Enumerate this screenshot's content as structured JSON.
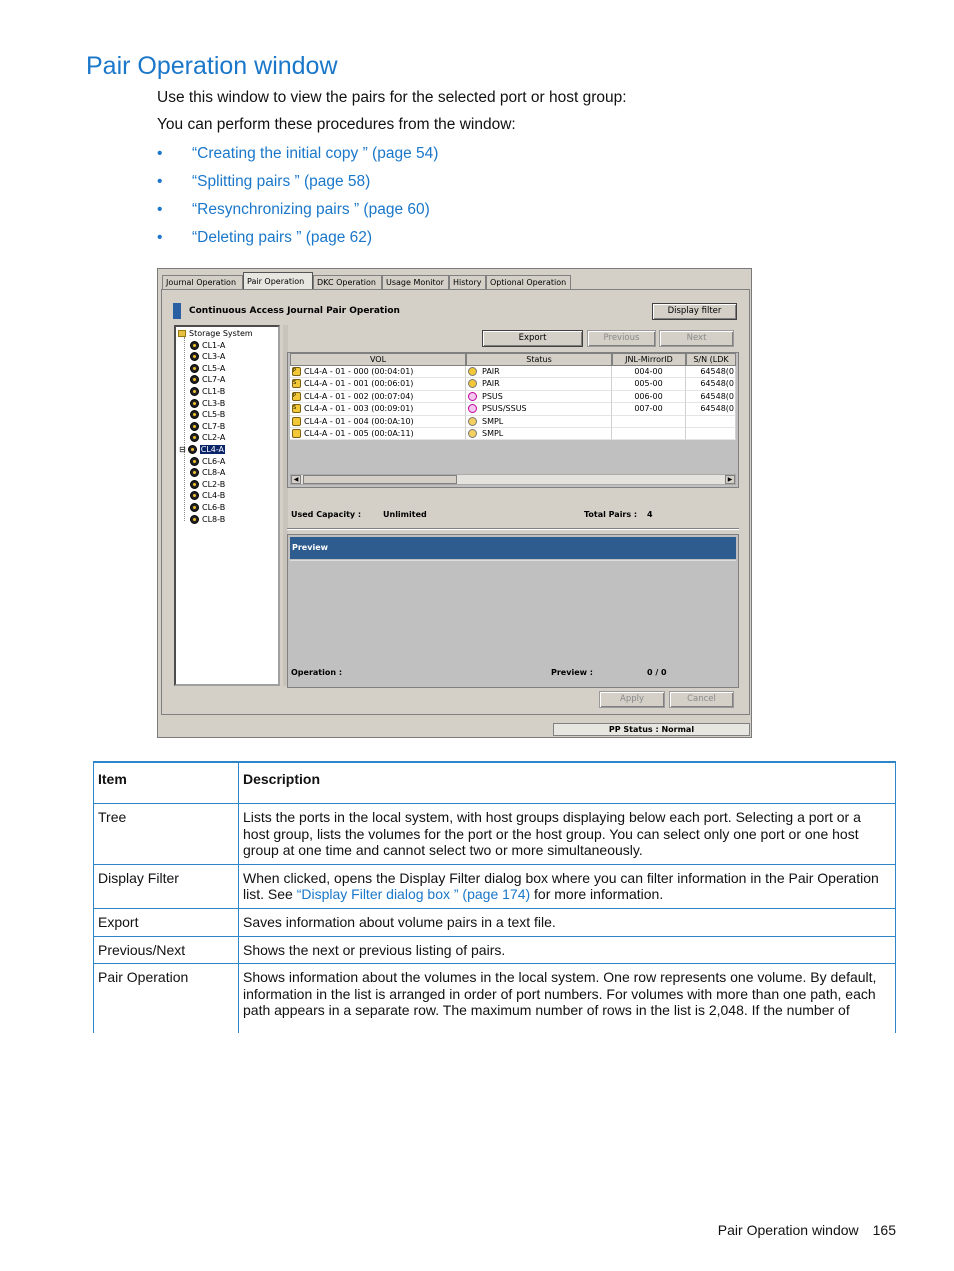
{
  "page_title": "Pair Operation window",
  "intro": "Use this window to view the pairs for the selected port or host group:",
  "procedures_intro": "You can perform these procedures from the window:",
  "procedures": [
    {
      "bullet": "•",
      "link": "“Creating the initial copy ” (page 54)"
    },
    {
      "bullet": "•",
      "link": "“Splitting pairs ” (page 58)"
    },
    {
      "bullet": "•",
      "link": "“Resynchronizing pairs ” (page 60)"
    },
    {
      "bullet": "•",
      "link": "“Deleting pairs ” (page 62)"
    }
  ],
  "screenshot": {
    "tabs": [
      "Journal Operation",
      "Pair Operation",
      "DKC Operation",
      "Usage Monitor",
      "History",
      "Optional Operation"
    ],
    "active_tab": "Pair Operation",
    "panel_title": "Continuous Access Journal Pair Operation",
    "display_filter_label": "Display filter",
    "export_label": "Export",
    "previous_label": "Previous",
    "next_label": "Next",
    "tree": {
      "root": "Storage System",
      "ports": [
        "CL1-A",
        "CL3-A",
        "CL5-A",
        "CL7-A",
        "CL1-B",
        "CL3-B",
        "CL5-B",
        "CL7-B",
        "CL2-A",
        "CL4-A",
        "CL6-A",
        "CL8-A",
        "CL2-B",
        "CL4-B",
        "CL6-B",
        "CL8-B"
      ],
      "expand_glyph": "⊟",
      "selected": "CL4-A"
    },
    "columns": [
      "VOL",
      "Status",
      "JNL-MirrorID",
      "S/N (LDK"
    ],
    "rows": [
      {
        "badge": "P",
        "vol": "CL4-A - 01 - 000 (00:04:01)",
        "status": "PAIR",
        "status_kind": "pair",
        "mirror": "004-00",
        "sn": "64548(0"
      },
      {
        "badge": "S",
        "vol": "CL4-A - 01 - 001 (00:06:01)",
        "status": "PAIR",
        "status_kind": "pair",
        "mirror": "005-00",
        "sn": "64548(0"
      },
      {
        "badge": "P",
        "vol": "CL4-A - 01 - 002 (00:07:04)",
        "status": "PSUS",
        "status_kind": "psus",
        "mirror": "006-00",
        "sn": "64548(0"
      },
      {
        "badge": "S",
        "vol": "CL4-A - 01 - 003 (00:09:01)",
        "status": "PSUS/SSUS",
        "status_kind": "psus",
        "mirror": "007-00",
        "sn": "64548(0"
      },
      {
        "badge": "",
        "vol": "CL4-A - 01 - 004 (00:0A:10)",
        "status": "SMPL",
        "status_kind": "smpl",
        "mirror": "",
        "sn": ""
      },
      {
        "badge": "",
        "vol": "CL4-A - 01 - 005 (00:0A:11)",
        "status": "SMPL",
        "status_kind": "smpl",
        "mirror": "",
        "sn": ""
      }
    ],
    "scroll_left": "◀",
    "scroll_right": "▶",
    "used_capacity_label": "Used Capacity :",
    "used_capacity_value": "Unlimited",
    "total_pairs_label": "Total Pairs :",
    "total_pairs_value": "4",
    "preview_label": "Preview",
    "operation_label": "Operation :",
    "preview_count_label": "Preview :",
    "preview_count_value": "0 / 0",
    "apply_label": "Apply",
    "cancel_label": "Cancel",
    "status_bar": "PP Status : Normal",
    "colors": {
      "preview_header": "#2e5c8e",
      "panel_marker": "#2b5fa4",
      "selection": "#0a246a"
    }
  },
  "table": {
    "headers": [
      "Item",
      "Description"
    ],
    "rows": [
      {
        "item": "Tree",
        "desc": "Lists the ports in the local system, with host groups displaying below each port. Selecting a port or a host group, lists the volumes for the port or the host group. You can select only one port or one host group at one time and cannot select two or more simultaneously."
      },
      {
        "item": "Display Filter",
        "desc_before": "When clicked, opens the Display Filter dialog box where you can filter information in the Pair Operation list. See ",
        "desc_link": "“Display Filter dialog box ” (page 174)",
        "desc_after": " for more information."
      },
      {
        "item": "Export",
        "desc": "Saves information about volume pairs in a text file."
      },
      {
        "item": "Previous/Next",
        "desc": "Shows the next or previous listing of pairs."
      },
      {
        "item": "Pair Operation",
        "desc": "Shows information about the volumes in the local system. One row represents one volume. By default, information in the list is arranged in order of port numbers. For volumes with more than one path, each path appears in a separate row. The maximum number of rows in the list is 2,048. If the number of"
      }
    ]
  },
  "footer": {
    "section": "Pair Operation window",
    "page_number": "165"
  },
  "colors": {
    "heading": "#1a77c9",
    "link": "#1a77c9",
    "table_rule": "#2d86c9"
  }
}
